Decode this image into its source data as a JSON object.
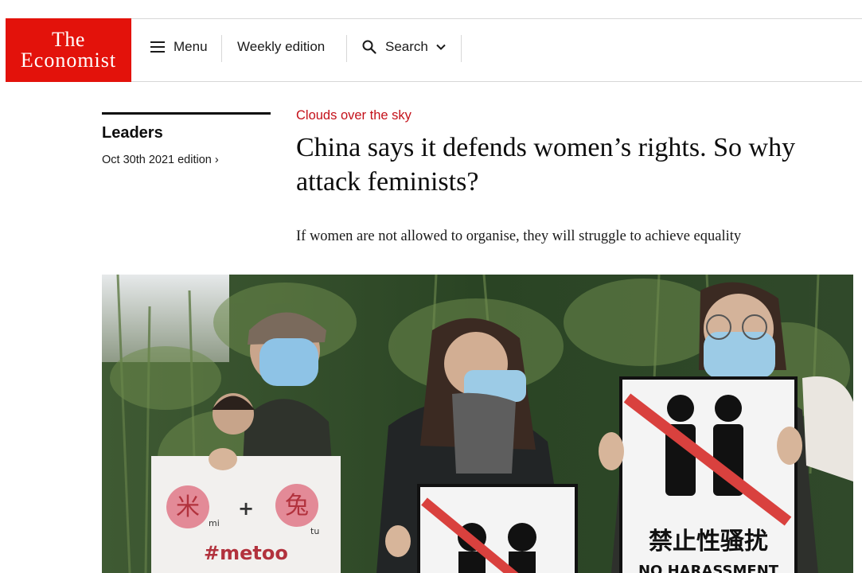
{
  "logo": {
    "line1": "The",
    "line2": "Economist",
    "color": "#e3120b"
  },
  "nav": {
    "menu_label": "Menu",
    "weekly_label": "Weekly edition",
    "search_label": "Search"
  },
  "section": {
    "name": "Leaders",
    "edition": "Oct 30th 2021 edition",
    "edition_chevron": "›"
  },
  "article": {
    "rubric": "Clouds over the sky",
    "headline": "China says it defends women’s rights. So why attack feminists?",
    "standfirst": "If women are not allowed to organise, they will struggle to achieve equality"
  },
  "hero_signs": {
    "left_char_1": "米",
    "left_char_1_label": "mi",
    "plus": "+",
    "left_char_2": "兔",
    "left_char_2_label": "tu",
    "hashtag": "#metoo",
    "right_chinese": "禁止性骚扰",
    "right_english": "NO HARASSMENT"
  },
  "colors": {
    "rubric": "#c4111a",
    "accent": "#e3120b"
  }
}
